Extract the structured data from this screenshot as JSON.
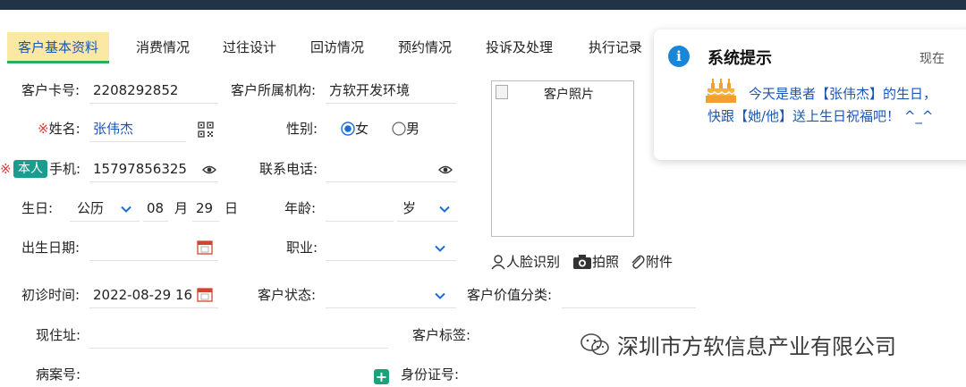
{
  "tabs": [
    {
      "label": "客户基本资料",
      "active": true
    },
    {
      "label": "消费情况"
    },
    {
      "label": "过往设计"
    },
    {
      "label": "回访情况"
    },
    {
      "label": "预约情况"
    },
    {
      "label": "投诉及处理"
    },
    {
      "label": "执行记录"
    }
  ],
  "form": {
    "card_label": "客户卡号:",
    "card_value": "2208292852",
    "org_label": "客户所属机构:",
    "org_value": "方软开发环境",
    "name_req": "※",
    "name_label": "姓名:",
    "name_value": "张伟杰",
    "gender_label": "性别:",
    "gender_female": "女",
    "gender_male": "男",
    "gender_selected": "女",
    "phone_req": "※",
    "phone_badge": "本人",
    "phone_label": "手机:",
    "phone_value": "15797856325",
    "contact_label": "联系电话:",
    "birthday_label": "生日:",
    "calendar_type": "公历",
    "birth_month": "08",
    "month_unit": "月",
    "birth_day": "29",
    "day_unit": "日",
    "age_label": "年龄:",
    "age_unit": "岁",
    "birthdate_label": "出生日期:",
    "job_label": "职业:",
    "first_visit_label": "初诊时间:",
    "first_visit_value": "2022-08-29 16",
    "status_label": "客户状态:",
    "value_class_label": "客户价值分类:",
    "address_label": "现住址:",
    "tags_label": "客户标签:",
    "record_label": "病案号:",
    "id_label": "身份证号:"
  },
  "photo": {
    "alt": "客户照片",
    "actions": [
      {
        "label": "人脸识别",
        "icon": "face-icon"
      },
      {
        "label": "拍照",
        "icon": "camera-icon"
      },
      {
        "label": "附件",
        "icon": "paperclip-icon"
      }
    ]
  },
  "toast": {
    "title": "系统提示",
    "time": "现在",
    "message": "今天是患者【张伟杰】的生日，快跟【她/他】送上生日祝福吧！ ^_^"
  },
  "watermark": "深圳市方软信息产业有限公司",
  "colors": {
    "topbar": "#213447",
    "active_tab_bg": "#fbe8a4",
    "active_tab_underline": "#27ae60",
    "link_blue": "#1a57b5",
    "required_red": "#e03a3a",
    "badge_teal": "#1a9c8e"
  }
}
